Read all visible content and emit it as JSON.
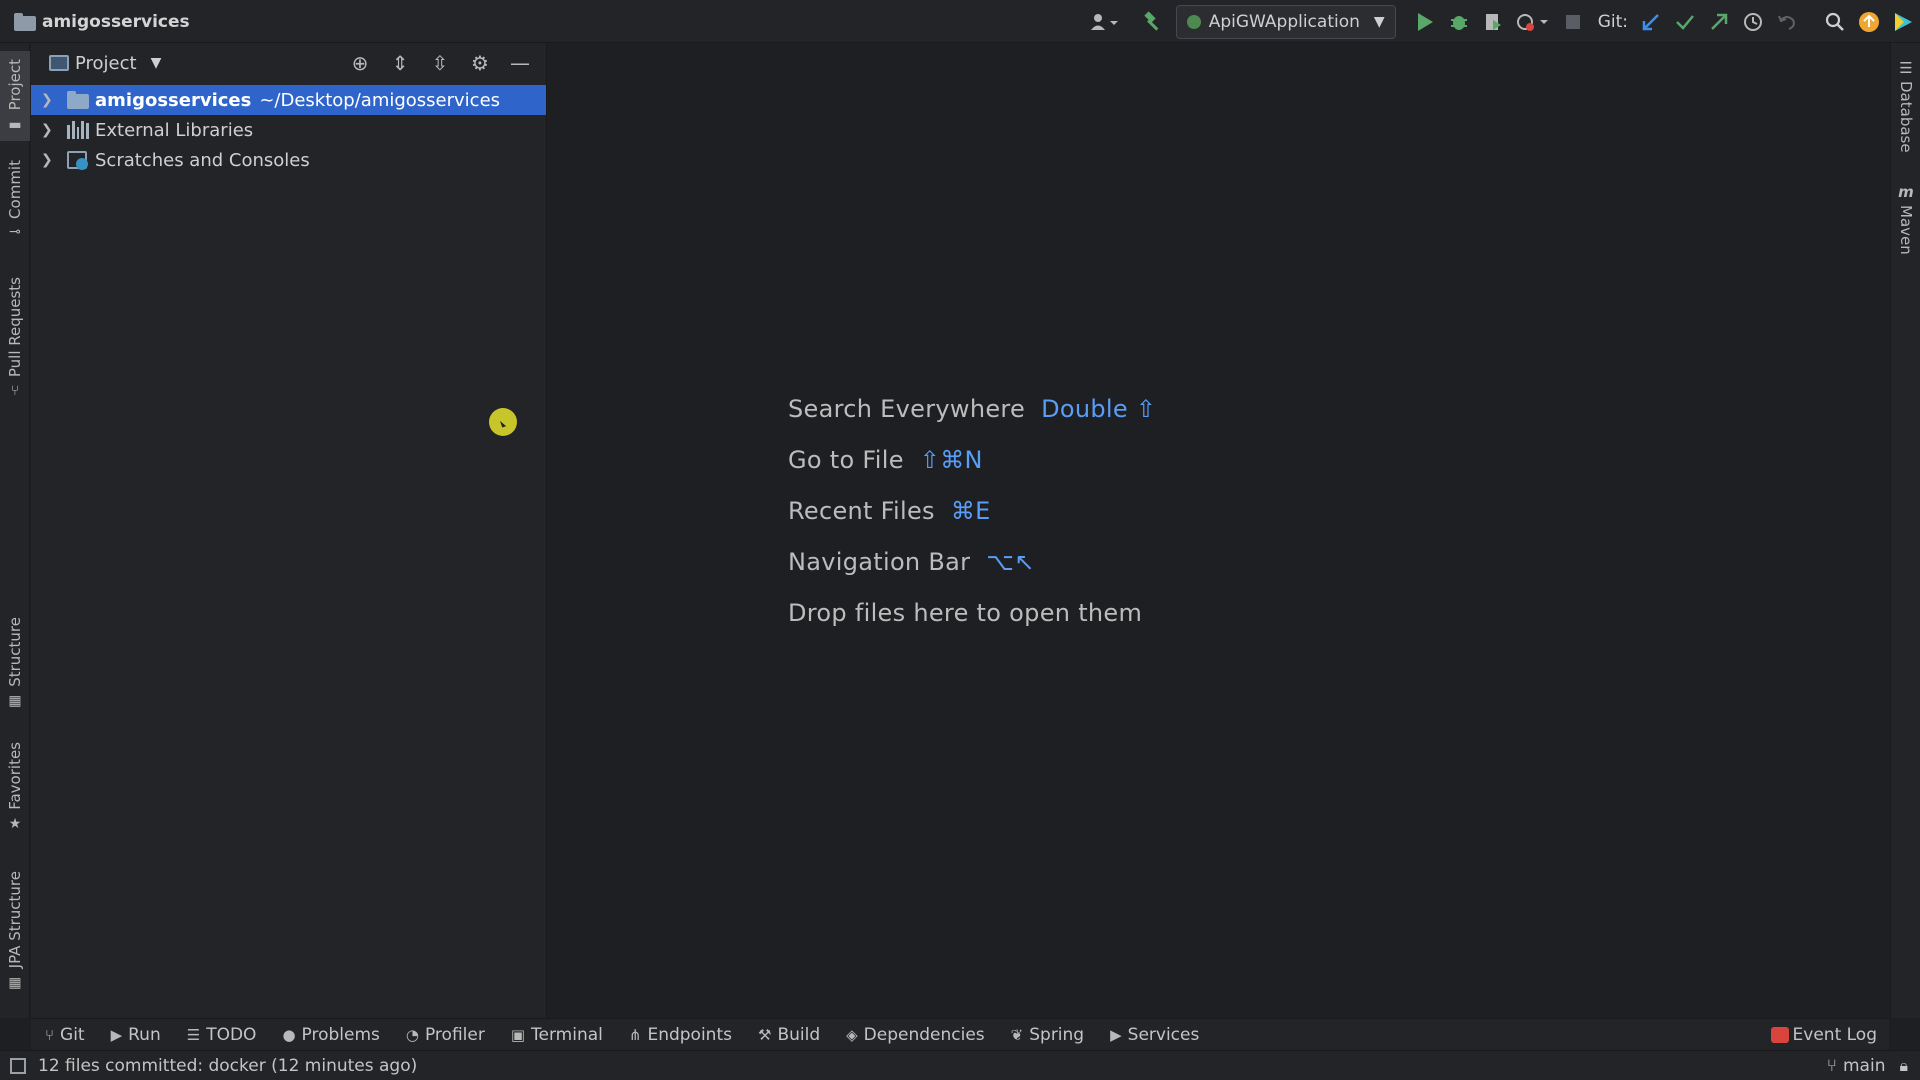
{
  "window": {
    "project_name": "amigosservices"
  },
  "toolbar": {
    "run_config": "ApiGWApplication",
    "git_label": "Git:"
  },
  "left_tool_tabs": [
    {
      "label": "Project"
    },
    {
      "label": "Commit"
    },
    {
      "label": "Pull Requests"
    },
    {
      "label": "Structure"
    },
    {
      "label": "Favorites"
    },
    {
      "label": "JPA Structure"
    }
  ],
  "right_tool_tabs": [
    {
      "label": "Database"
    },
    {
      "label": "Maven"
    }
  ],
  "project_panel": {
    "title": "Project",
    "tree": [
      {
        "name": "amigosservices",
        "path": "~/Desktop/amigosservices",
        "selected": true
      },
      {
        "name": "External Libraries"
      },
      {
        "name": "Scratches and Consoles"
      }
    ]
  },
  "editor": {
    "hints": [
      {
        "label": "Search Everywhere",
        "shortcut": "Double ⇧"
      },
      {
        "label": "Go to File",
        "shortcut": "⇧⌘N"
      },
      {
        "label": "Recent Files",
        "shortcut": "⌘E"
      },
      {
        "label": "Navigation Bar",
        "shortcut": "⌥↖"
      },
      {
        "label": "Drop files here to open them",
        "shortcut": ""
      }
    ]
  },
  "bottom_tabs": [
    {
      "label": "Git",
      "icon": "branch-icon"
    },
    {
      "label": "Run",
      "icon": "play-icon"
    },
    {
      "label": "TODO",
      "icon": "list-icon"
    },
    {
      "label": "Problems",
      "icon": "info-icon"
    },
    {
      "label": "Profiler",
      "icon": "profiler-icon"
    },
    {
      "label": "Terminal",
      "icon": "terminal-icon"
    },
    {
      "label": "Endpoints",
      "icon": "endpoints-icon"
    },
    {
      "label": "Build",
      "icon": "hammer-icon"
    },
    {
      "label": "Dependencies",
      "icon": "layers-icon"
    },
    {
      "label": "Spring",
      "icon": "leaf-icon"
    },
    {
      "label": "Services",
      "icon": "services-icon"
    }
  ],
  "event_log": "Event Log",
  "status": {
    "message": "12 files committed: docker (12 minutes ago)",
    "branch": "main"
  },
  "colors": {
    "accent": "#2f65ca",
    "shortcut": "#589df6",
    "run_green": "#59a869",
    "background": "#1e1f22"
  }
}
